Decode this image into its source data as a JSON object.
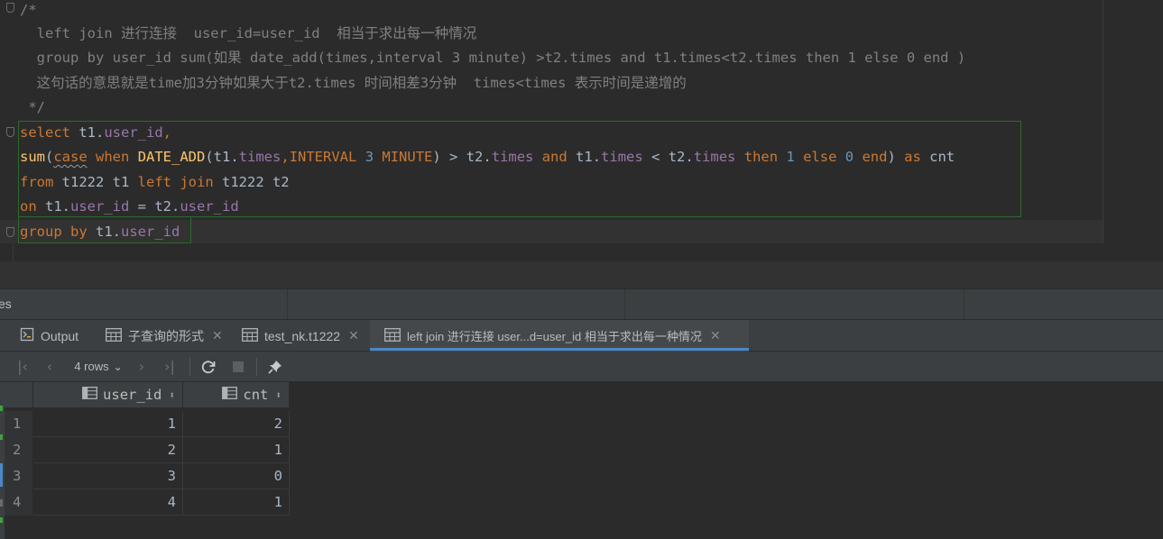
{
  "editor": {
    "comment": {
      "open": "/*",
      "line1": "  left join 进行连接  user_id=user_id  相当于求出每一种情况",
      "line2": "  group by user_id sum(如果 date_add(times,interval 3 minute) >t2.times and t1.times<t2.times then 1 else 0 end )",
      "line3": "  这句话的意思就是time加3分钟如果大于t2.times 时间相差3分钟  times<times 表示时间是递增的",
      "close": " */"
    },
    "sql": {
      "l1": [
        "select",
        " t1.",
        "user_id",
        ","
      ],
      "l2": [
        "sum",
        "(",
        "case",
        " ",
        "when",
        " ",
        "DATE_ADD",
        "(t1.",
        "times",
        ",",
        "INTERVAL",
        " ",
        "3",
        " ",
        "MINUTE",
        ") > t2.",
        "times",
        " ",
        "and",
        " t1.",
        "times",
        " < t2.",
        "times",
        " ",
        "then",
        " ",
        "1",
        " ",
        "else",
        " ",
        "0",
        " ",
        "end",
        ") ",
        "as",
        " cnt"
      ],
      "l3": [
        "from",
        " t1222 t1 ",
        "left",
        " ",
        "join",
        " t1222 t2"
      ],
      "l4": [
        "on",
        " t1.",
        "user_id",
        " = t2.",
        "user_id"
      ],
      "l5": [
        "group",
        " ",
        "by",
        " t1.",
        "user_id"
      ]
    }
  },
  "services": {
    "label": "es"
  },
  "tabs": [
    {
      "label": "Output",
      "icon": "output-icon"
    },
    {
      "label": "子查询的形式",
      "icon": "table-icon"
    },
    {
      "label": "test_nk.t1222",
      "icon": "table-icon"
    },
    {
      "label": "left join 进行连接  user...d=user_id  相当于求出每一种情况",
      "icon": "table-icon"
    }
  ],
  "toolbar": {
    "rows_label": "4 rows"
  },
  "grid": {
    "columns": [
      "user_id",
      "cnt"
    ],
    "rows": [
      {
        "n": "1",
        "user_id": "1",
        "cnt": "2"
      },
      {
        "n": "2",
        "user_id": "2",
        "cnt": "1"
      },
      {
        "n": "3",
        "user_id": "3",
        "cnt": "0"
      },
      {
        "n": "4",
        "user_id": "4",
        "cnt": "1"
      }
    ]
  },
  "colors": {
    "keyword": "#cc7832",
    "function": "#ffc66d",
    "column": "#9876aa",
    "number": "#6897bb",
    "comment": "#808080",
    "text": "#a9b7c6",
    "background": "#2b2b2b",
    "accent": "#4a88c7"
  }
}
